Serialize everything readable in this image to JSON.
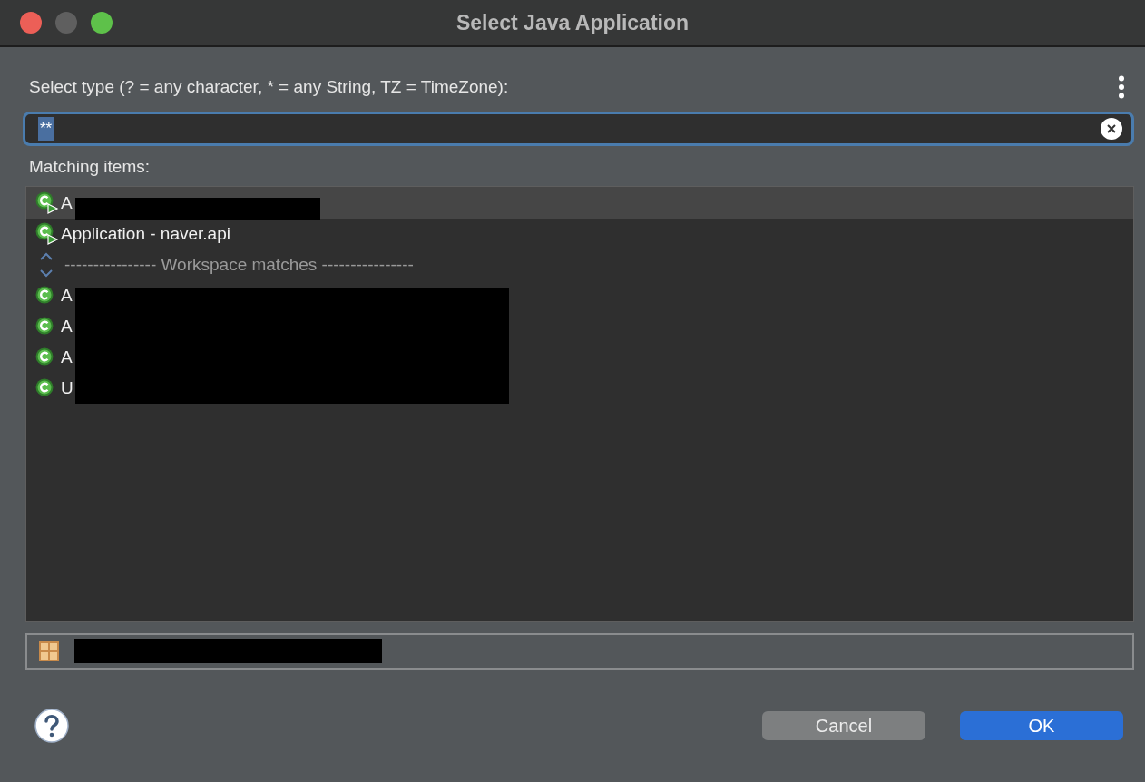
{
  "window": {
    "title": "Select Java Application"
  },
  "filter": {
    "label": "Select type (? = any character, * = any String, TZ = TimeZone):",
    "value": "**"
  },
  "matching_label": "Matching items:",
  "items": [
    {
      "kind": "launchable",
      "label": "A",
      "selected": true,
      "redacted": true
    },
    {
      "kind": "launchable",
      "label": "Application - naver.api",
      "selected": false,
      "redacted": false
    },
    {
      "kind": "separator",
      "label": "---------------- Workspace matches ----------------",
      "selected": false
    },
    {
      "kind": "class",
      "label": "A",
      "selected": false,
      "redacted": true
    },
    {
      "kind": "class",
      "label": "A",
      "selected": false,
      "redacted": true
    },
    {
      "kind": "class",
      "label": "A",
      "selected": false,
      "redacted": true
    },
    {
      "kind": "class",
      "label": "U",
      "selected": false,
      "redacted": true
    }
  ],
  "location": {
    "redacted": true
  },
  "buttons": [
    {
      "label": "Cancel",
      "kind": "secondary"
    },
    {
      "label": "OK",
      "kind": "primary"
    }
  ]
}
